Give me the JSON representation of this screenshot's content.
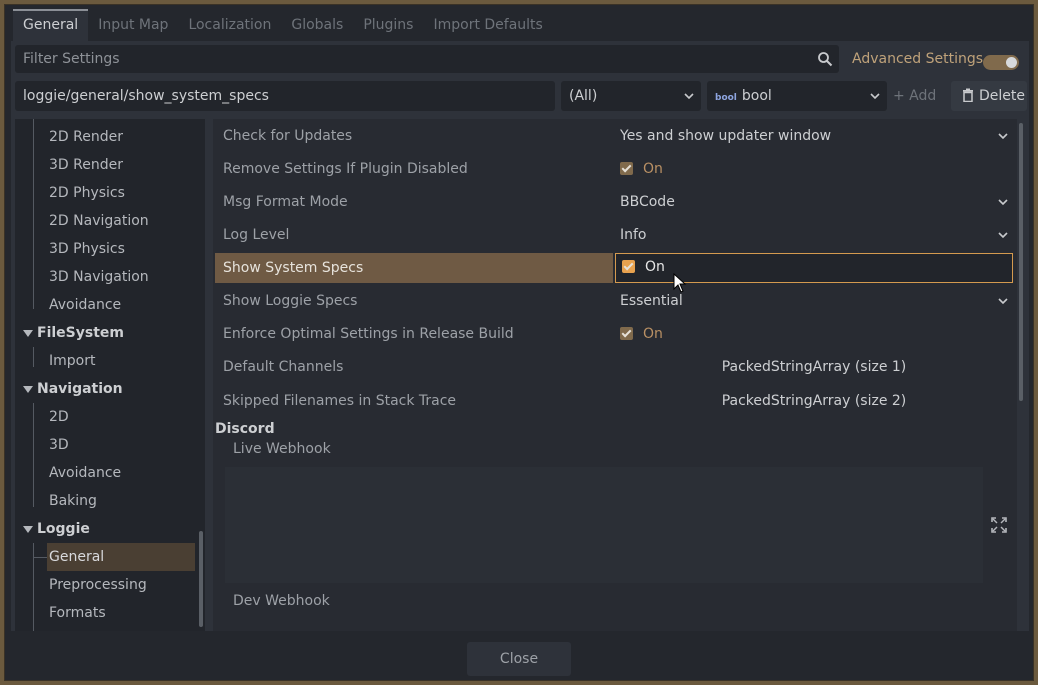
{
  "tabs": [
    "General",
    "Input Map",
    "Localization",
    "Globals",
    "Plugins",
    "Import Defaults"
  ],
  "filter": {
    "placeholder": "Filter Settings"
  },
  "advanced": {
    "label": "Advanced Settings",
    "enabled": true
  },
  "toolbar": {
    "path": "loggie/general/show_system_specs",
    "feature": "(All)",
    "type_badge": "bool",
    "type": "bool",
    "add_label": "+ Add",
    "delete_label": "Delete"
  },
  "tree": {
    "render_items": [
      "2D Render",
      "3D Render",
      "2D Physics",
      "2D Navigation",
      "3D Physics",
      "3D Navigation",
      "Avoidance"
    ],
    "filesystem": {
      "label": "FileSystem",
      "items": [
        "Import"
      ]
    },
    "navigation": {
      "label": "Navigation",
      "items": [
        "2D",
        "3D",
        "Avoidance",
        "Baking"
      ]
    },
    "loggie": {
      "label": "Loggie",
      "items": [
        "General",
        "Preprocessing",
        "Formats"
      ]
    }
  },
  "properties": [
    {
      "name": "Check for Updates",
      "value": "Yes and show updater window",
      "kind": "dropdown"
    },
    {
      "name": "Remove Settings If Plugin Disabled",
      "value": "On",
      "kind": "checkbox"
    },
    {
      "name": "Msg Format Mode",
      "value": "BBCode",
      "kind": "dropdown"
    },
    {
      "name": "Log Level",
      "value": "Info",
      "kind": "dropdown"
    },
    {
      "name": "Show System Specs",
      "value": "On",
      "kind": "checkbox"
    },
    {
      "name": "Show Loggie Specs",
      "value": "Essential",
      "kind": "dropdown"
    },
    {
      "name": "Enforce Optimal Settings in Release Build",
      "value": "On",
      "kind": "checkbox"
    },
    {
      "name": "Default Channels",
      "value": "PackedStringArray (size 1)",
      "kind": "array"
    },
    {
      "name": "Skipped Filenames in Stack Trace",
      "value": "PackedStringArray (size 2)",
      "kind": "array"
    }
  ],
  "discord": {
    "label": "Discord",
    "live_webhook": "Live Webhook",
    "dev_webhook": "Dev Webhook"
  },
  "footer": {
    "close_label": "Close"
  },
  "colors": {
    "accent": "#d49a4f",
    "selection": "#6f5a44",
    "checkbox": "#806a4c"
  },
  "icons": [
    "search-icon",
    "chevron-down-icon",
    "plus-icon",
    "trash-icon",
    "expand-icon",
    "mouse-cursor-icon"
  ]
}
